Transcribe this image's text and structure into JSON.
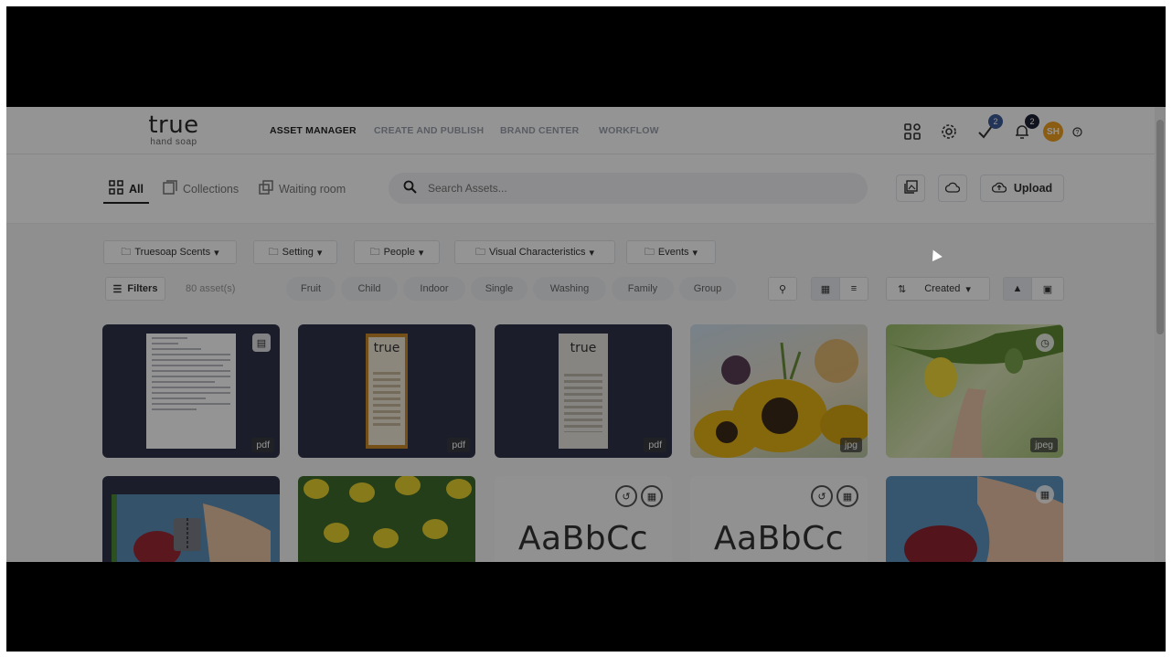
{
  "brand": {
    "logo_main": "true",
    "logo_sub": "hand soap"
  },
  "nav": {
    "tabs": [
      {
        "label": "ASSET MANAGER",
        "active": true
      },
      {
        "label": "CREATE AND PUBLISH",
        "active": false
      },
      {
        "label": "BRAND CENTER",
        "active": false
      },
      {
        "label": "WORKFLOW",
        "active": false
      }
    ],
    "icons": [
      "apps-grid-icon",
      "settings-gear-icon",
      "tasks-check-icon",
      "notifications-bell-icon",
      "help-icon"
    ],
    "tasks_badge": "2",
    "notifications_badge": "2",
    "avatar_initials": "SH",
    "avatar_color": "#f0a020"
  },
  "subnav": {
    "tabs": [
      {
        "label": "All",
        "icon": "grid-icon",
        "active": true
      },
      {
        "label": "Collections",
        "icon": "collections-icon",
        "active": false
      },
      {
        "label": "Waiting room",
        "icon": "waiting-room-icon",
        "active": false
      }
    ],
    "search_placeholder": "Search Assets...",
    "upload_label": "Upload"
  },
  "filters": {
    "dropdowns": [
      "Truesoap Scents",
      "Setting",
      "People",
      "Visual Characteristics",
      "Events"
    ],
    "filters_label": "Filters",
    "asset_count": "80 asset(s)",
    "tags": [
      "Fruit",
      "Child",
      "Indoor",
      "Single",
      "Washing",
      "Family",
      "Group"
    ],
    "sort_label": "Created"
  },
  "assets": {
    "row1": [
      {
        "kind": "document",
        "ext": "pdf"
      },
      {
        "kind": "flyer-orange",
        "ext": "pdf",
        "logo": "true"
      },
      {
        "kind": "flyer-light",
        "ext": "pdf",
        "logo": "true"
      },
      {
        "kind": "photo-sunflowers",
        "ext": "jpg"
      },
      {
        "kind": "photo-lemon-tree",
        "ext": "jpeg"
      }
    ],
    "row2": [
      {
        "kind": "photo-zip-pomegranate"
      },
      {
        "kind": "photo-lemons-green"
      },
      {
        "kind": "font",
        "sample": "AaBbCc"
      },
      {
        "kind": "font",
        "sample": "AaBbCc"
      },
      {
        "kind": "photo-pomegranate-hand"
      }
    ]
  },
  "colors": {
    "accent": "#222222",
    "card_dark": "#2f3549",
    "overlay": "rgba(0,0,0,0.42)"
  }
}
